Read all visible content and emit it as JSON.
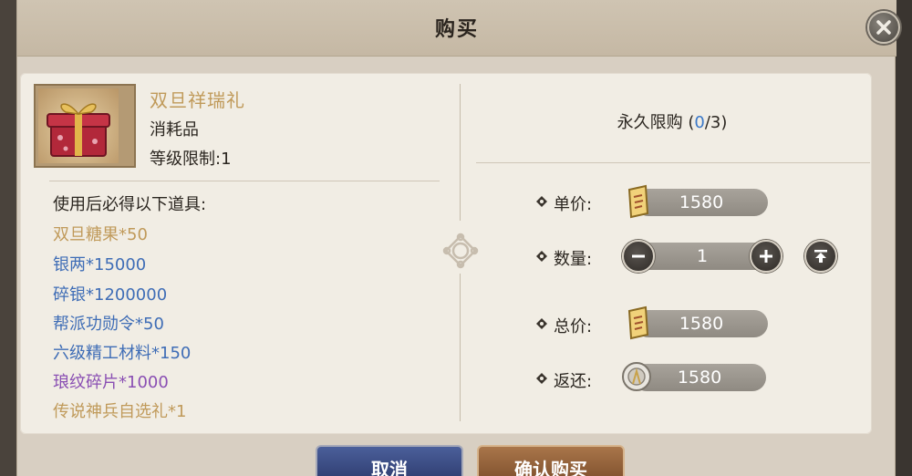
{
  "dialog": {
    "title": "购买"
  },
  "item": {
    "name": "双旦祥瑞礼",
    "type": "消耗品",
    "level_limit": "等级限制:1"
  },
  "rewards": {
    "title": "使用后必得以下道具:",
    "items": [
      {
        "text": "双旦糖果*50",
        "color": "#c09a5a"
      },
      {
        "text": "银两*15000",
        "color": "#3f6db6"
      },
      {
        "text": "碎银*1200000",
        "color": "#3f6db6"
      },
      {
        "text": "帮派功勋令*50",
        "color": "#3f6db6"
      },
      {
        "text": "六级精工材料*150",
        "color": "#3f6db6"
      },
      {
        "text": "琅纹碎片*1000",
        "color": "#8a4fb3"
      },
      {
        "text": "传说神兵自选礼*1",
        "color": "#c09a5a"
      }
    ]
  },
  "purchase": {
    "limit_label": "永久限购 (",
    "limit_current": "0",
    "limit_suffix": "/3)",
    "unit_price_label": "单价:",
    "unit_price": "1580",
    "quantity_label": "数量:",
    "quantity": "1",
    "total_label": "总价:",
    "total_price": "1580",
    "rebate_label": "返还:",
    "rebate": "1580"
  },
  "buttons": {
    "cancel": "取消",
    "confirm": "确认购买"
  },
  "icons": {
    "close": "close-icon",
    "gift": "gift-box-icon",
    "currency": "gold-scroll-icon",
    "rebate": "silver-coin-icon",
    "minus": "minus-icon",
    "plus": "plus-icon",
    "max": "max-arrow-icon"
  },
  "colors": {
    "panel_bg": "#f1ede4",
    "item_name": "#c09a5a",
    "blue_reward": "#3f6db6",
    "purple_reward": "#8a4fb3",
    "limit_number": "#3a78c8"
  }
}
